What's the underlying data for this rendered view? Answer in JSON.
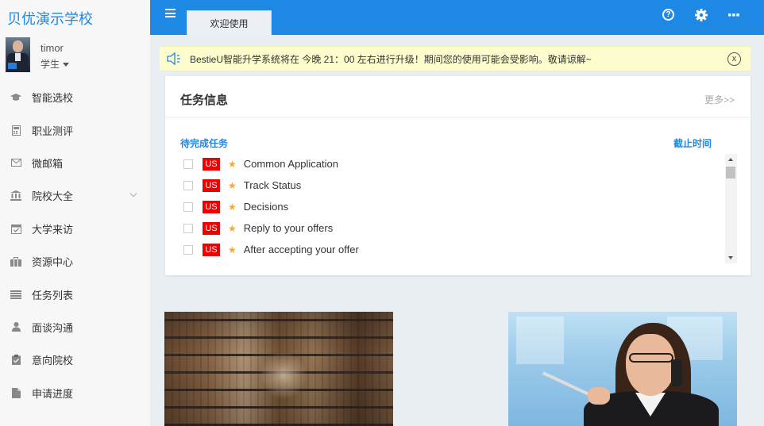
{
  "sidebar": {
    "brand": "贝优演示学校",
    "user": {
      "name": "timor",
      "role": "学生"
    },
    "items": [
      {
        "label": "智能选校",
        "icon": "graduation-cap-icon"
      },
      {
        "label": "职业测评",
        "icon": "calculator-icon"
      },
      {
        "label": "微邮箱",
        "icon": "envelope-icon"
      },
      {
        "label": "院校大全",
        "icon": "institution-icon",
        "expandable": true
      },
      {
        "label": "大学来访",
        "icon": "calendar-check-icon"
      },
      {
        "label": "资源中心",
        "icon": "briefcase-icon"
      },
      {
        "label": "任务列表",
        "icon": "list-icon"
      },
      {
        "label": "面谈沟通",
        "icon": "user-icon"
      },
      {
        "label": "意向院校",
        "icon": "clipboard-check-icon"
      },
      {
        "label": "申请进度",
        "icon": "file-icon"
      }
    ]
  },
  "topbar": {
    "tab": "欢迎使用",
    "icons": [
      "help-icon",
      "gear-icon",
      "more-icon"
    ],
    "accent": "#1e88e5"
  },
  "notice": {
    "text": "BestieU智能升学系统将在 今晚 21：00 左右进行升级！期间您的使用可能会受影响。敬请谅解~"
  },
  "task_card": {
    "title": "任务信息",
    "more": "更多>>",
    "col_pending": "待完成任务",
    "col_deadline": "截止时间",
    "tasks": [
      {
        "tag": "US",
        "name": "Common Application"
      },
      {
        "tag": "US",
        "name": "Track Status"
      },
      {
        "tag": "US",
        "name": "Decisions"
      },
      {
        "tag": "US",
        "name": "Reply to your offers"
      },
      {
        "tag": "US",
        "name": "After accepting your offer"
      }
    ]
  }
}
